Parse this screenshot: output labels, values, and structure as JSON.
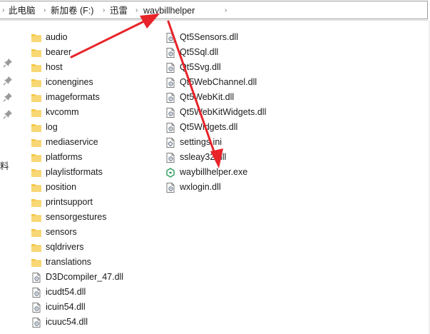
{
  "breadcrumb": {
    "items": [
      "此电脑",
      "新加卷 (F:)",
      "迅雷",
      "waybillhelper"
    ]
  },
  "sidebar": {
    "truncated_label": "料"
  },
  "folders": [
    "audio",
    "bearer",
    "host",
    "iconengines",
    "imageformats",
    "kvcomm",
    "log",
    "mediaservice",
    "platforms",
    "playlistformats",
    "position",
    "printsupport",
    "sensorgestures",
    "sensors",
    "sqldrivers",
    "translations"
  ],
  "files_left": [
    "D3Dcompiler_47.dll",
    "icudt54.dll",
    "icuin54.dll",
    "icuuc54.dll"
  ],
  "files_right": [
    "Qt5Sensors.dll",
    "Qt5Sql.dll",
    "Qt5Svg.dll",
    "Qt5WebChannel.dll",
    "Qt5WebKit.dll",
    "Qt5WebKitWidgets.dll",
    "Qt5Widgets.dll",
    "settings.ini",
    "ssleay32.dll",
    "waybillhelper.exe",
    "wxlogin.dll"
  ],
  "colors": {
    "folder": "#f4c542",
    "annotation": "#e8242a",
    "accent_exe": "#2e9e5e"
  }
}
